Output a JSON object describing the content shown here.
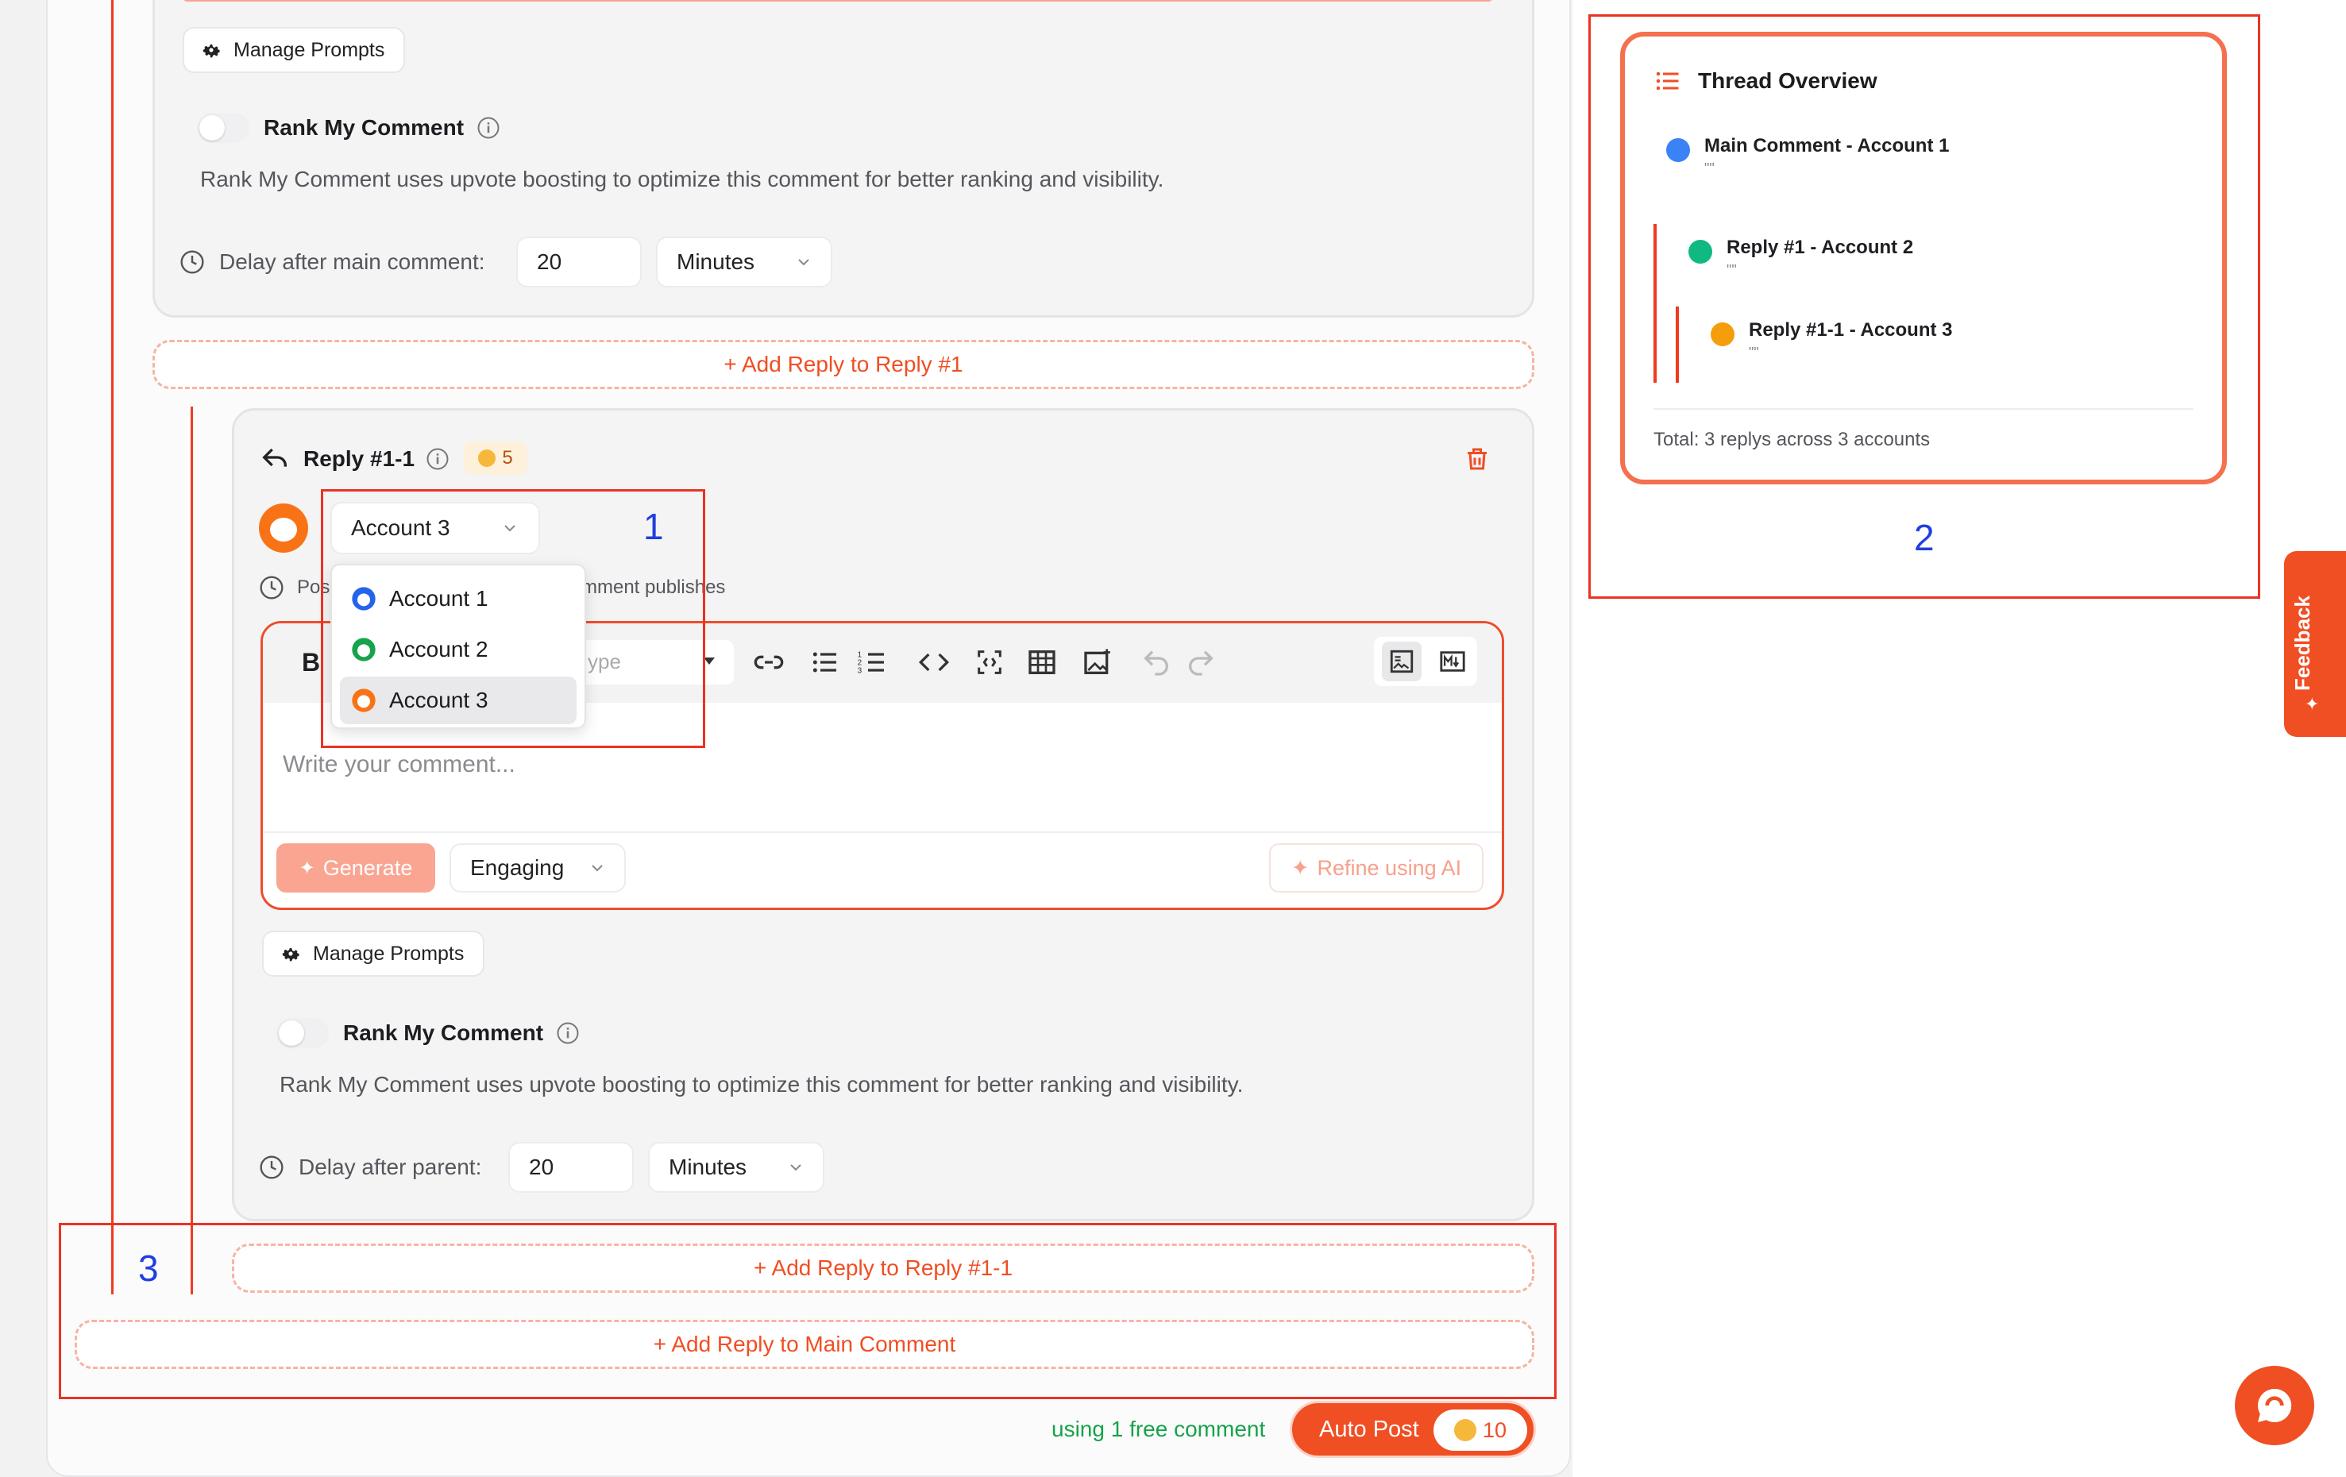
{
  "colors": {
    "accent": "#f04e23",
    "annotation_red": "#ea3323",
    "annotation_blue": "#1f3fe0",
    "account1_dot": "#3b82f6",
    "account2_dot": "#10b981",
    "account3_dot": "#f59e0b",
    "free_comment_green": "#16a34a"
  },
  "top_panel": {
    "manage_prompts": "Manage Prompts",
    "rank_label": "Rank My Comment",
    "rank_desc": "Rank My Comment uses upvote boosting to optimize this comment for better ranking and visibility.",
    "delay_label": "Delay after main comment:",
    "delay_value": "20",
    "delay_unit": "Minutes"
  },
  "add_reply_1": "+ Add Reply to Reply #1",
  "reply_panel": {
    "title": "Reply #1-1",
    "credits": "5",
    "account_selected": "Account 3",
    "post_hint_left": "Pos",
    "post_hint_right": "mment publishes",
    "dropdown": [
      "Account 1",
      "Account 2",
      "Account 3"
    ],
    "editor": {
      "bold_glyph": "B",
      "type_placeholder": "ype",
      "placeholder": "Write your comment...",
      "generate": "Generate",
      "tone": "Engaging",
      "refine": "Refine using AI"
    },
    "manage_prompts": "Manage Prompts",
    "rank_label": "Rank My Comment",
    "rank_desc": "Rank My Comment uses upvote boosting to optimize this comment for better ranking and visibility.",
    "delay_label": "Delay after parent:",
    "delay_value": "20",
    "delay_unit": "Minutes"
  },
  "add_reply_1_1": "+ Add Reply to Reply #1-1",
  "add_reply_main": "+ Add Reply to Main Comment",
  "footer": {
    "free_comment": "using 1 free comment",
    "auto_post": "Auto Post",
    "credits": "10"
  },
  "thread_overview": {
    "title": "Thread Overview",
    "items": [
      {
        "label": "Main Comment - Account 1",
        "sub": "\"\""
      },
      {
        "label": "Reply #1 - Account 2",
        "sub": "\"\""
      },
      {
        "label": "Reply #1-1 - Account 3",
        "sub": "\"\""
      }
    ],
    "total": "Total: 3 replys across 3 accounts"
  },
  "annotations": {
    "one": "1",
    "two": "2",
    "three": "3"
  },
  "feedback_tab": "Feedback"
}
